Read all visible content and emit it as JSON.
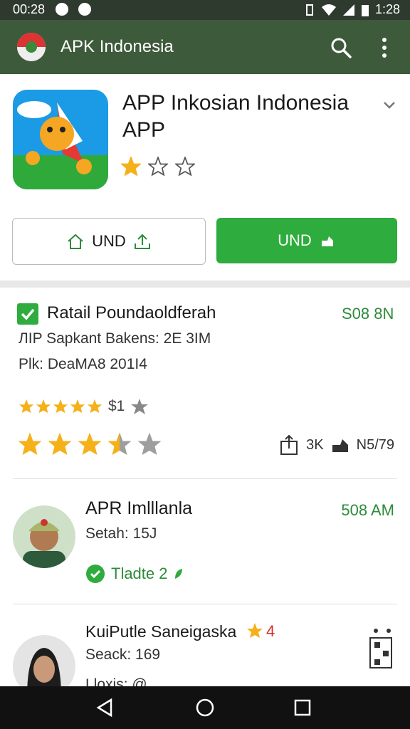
{
  "status_bar": {
    "time": "00:28",
    "right_time": "1:28"
  },
  "app_bar": {
    "title": "APK Indonesia"
  },
  "app": {
    "title": "APP Inkosian Indonesia APP",
    "rating_stars": 1,
    "rating_max": 5,
    "button_left": "UND",
    "button_right": "UND"
  },
  "details": {
    "name": "Ratail Poundaoldferah",
    "meta": "S08 8N",
    "line1": "ЛIP Sapkant Bakens: 2E 3IM",
    "line2": "Plk: DeaMA8 201I4",
    "small_rating_count": "$1",
    "small_rating_value": 5,
    "big_rating_value": 3.5,
    "big_rating_max": 5,
    "stat_share": "3K",
    "stat_install": "N5/79"
  },
  "reviews": [
    {
      "name": "APR Imlllanla",
      "sub": "Setah: 15J",
      "time": "508 AM",
      "tag": "Tladte 2"
    },
    {
      "name": "KuiPutle Saneigaska",
      "sub": "Seack: 169",
      "extra": "Lloxis: @",
      "badge": "4"
    }
  ],
  "colors": {
    "accent_green": "#2eac3d",
    "app_bar": "#3d5a3a",
    "star": "#f5b01a"
  }
}
